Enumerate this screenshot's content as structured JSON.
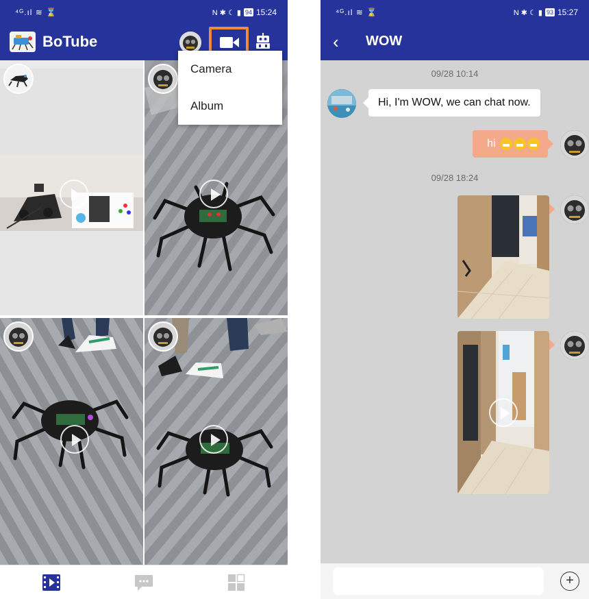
{
  "left_screen": {
    "status_bar": {
      "left_icons": "signal-wifi-hourglass",
      "battery": "94",
      "time": "15:24"
    },
    "app_bar": {
      "title": "BoTube",
      "logo_icon": "botube-logo-icon",
      "camera_icon": "video-camera-icon",
      "robot_icon": "robot-icon",
      "highlight_color": "#f08a3a"
    },
    "menu": {
      "items": [
        {
          "label": "Camera"
        },
        {
          "label": "Album"
        }
      ]
    },
    "bottom_nav": {
      "items": [
        {
          "icon": "video-feed-icon",
          "active": true
        },
        {
          "icon": "chat-icon",
          "active": false
        },
        {
          "icon": "apps-grid-icon",
          "active": false
        }
      ]
    },
    "colors": {
      "primary": "#25339b",
      "nav_active": "#25339b",
      "nav_inactive": "#c7c7c7"
    }
  },
  "right_screen": {
    "status_bar": {
      "left_icons": "signal-wifi-hourglass",
      "battery": "93",
      "time": "15:27"
    },
    "app_bar": {
      "back_icon": "back-chevron-icon",
      "title": "WOW"
    },
    "messages": [
      {
        "type": "timestamp",
        "text": "09/28 10:14"
      },
      {
        "type": "text",
        "direction": "incoming",
        "text": "Hi, I'm WOW, we can chat now."
      },
      {
        "type": "text",
        "direction": "outgoing",
        "text": "hi",
        "emoji_count": 3
      },
      {
        "type": "timestamp",
        "text": "09/28 18:24"
      },
      {
        "type": "image",
        "direction": "outgoing"
      },
      {
        "type": "video",
        "direction": "outgoing"
      }
    ],
    "composer": {
      "placeholder": "",
      "value": "",
      "add_icon": "plus-circle-icon"
    },
    "colors": {
      "outgoing_bubble": "#f4a98a",
      "incoming_bubble": "#ffffff",
      "background": "#d3d3d3"
    }
  }
}
